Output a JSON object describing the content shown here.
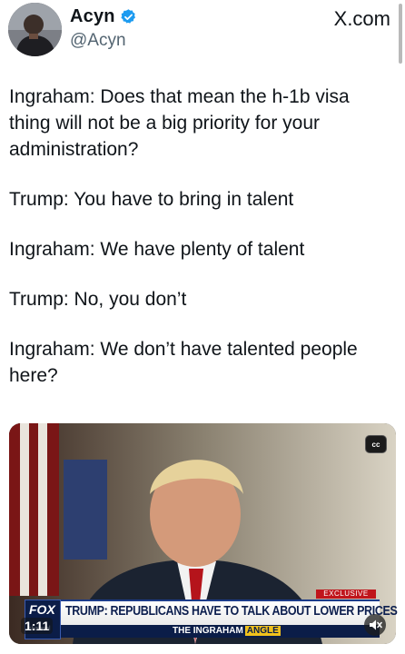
{
  "author": {
    "display_name": "Acyn",
    "handle": "@Acyn",
    "verified": true,
    "verified_color": "#1d9bf0"
  },
  "source_label": "X.com",
  "tweet_lines": [
    "Ingraham: Does that mean the h-1b visa thing will not be a big priority for your administration?",
    "Trump: You have to bring in talent",
    "Ingraham: We have plenty of talent",
    "Trump: No, you don’t",
    "Ingraham: We don’t have talented people here?"
  ],
  "video": {
    "cc_label": "cc",
    "exclusive_label": "EXCLUSIVE",
    "headline": "TRUMP: REPUBLICANS HAVE TO TALK ABOUT LOWER PRICES",
    "show_name_prefix": "THE INGRAHAM",
    "show_name_suffix": "ANGLE",
    "channel_logo": "FOX",
    "channel_sub": "channel",
    "timestamp": "1:11",
    "mute_icon": "speaker-muted-icon"
  }
}
